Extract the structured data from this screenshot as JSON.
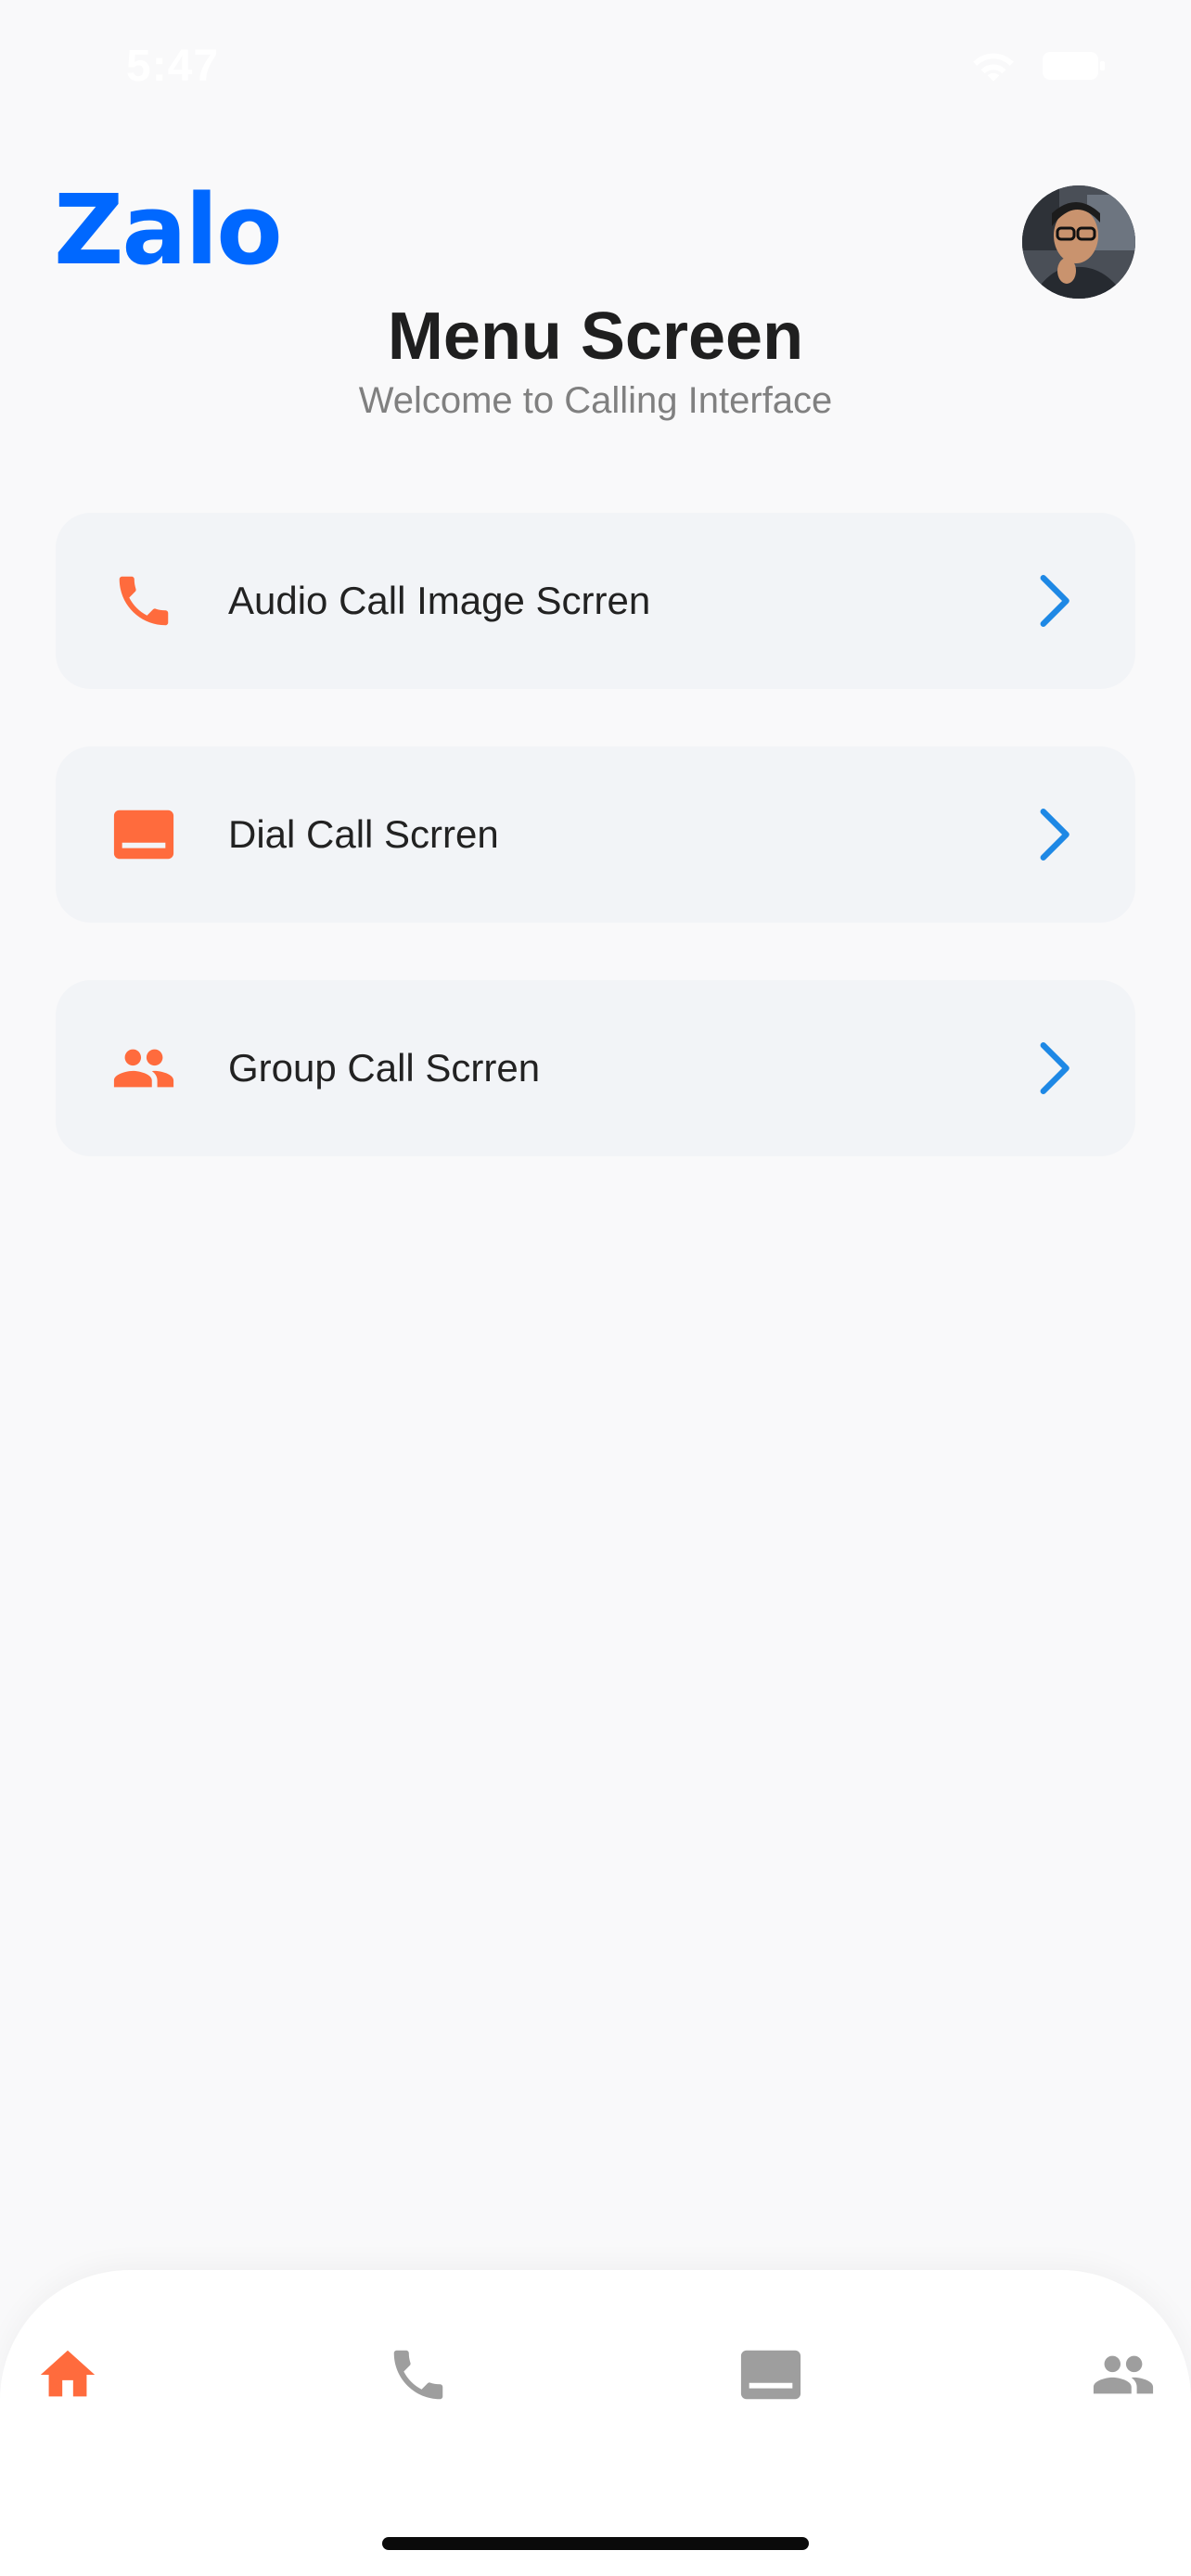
{
  "status_bar": {
    "time": "5:47"
  },
  "header": {
    "logo_text": "Zalo",
    "title": "Menu Screen",
    "subtitle": "Welcome to Calling Interface"
  },
  "menu": {
    "items": [
      {
        "label": "Audio Call Image Scrren",
        "icon": "phone-icon"
      },
      {
        "label": "Dial Call Scrren",
        "icon": "dialpad-icon"
      },
      {
        "label": "Group Call Scrren",
        "icon": "group-icon"
      }
    ]
  },
  "bottom_nav": {
    "items": [
      {
        "icon": "home-icon",
        "active": true
      },
      {
        "icon": "phone-icon",
        "active": false
      },
      {
        "icon": "dialpad-icon",
        "active": false
      },
      {
        "icon": "group-icon",
        "active": false
      }
    ]
  },
  "colors": {
    "accent": "#ff6b3d",
    "brand": "#0068ff",
    "chevron": "#1e88e5",
    "inactive": "#9e9e9e"
  }
}
